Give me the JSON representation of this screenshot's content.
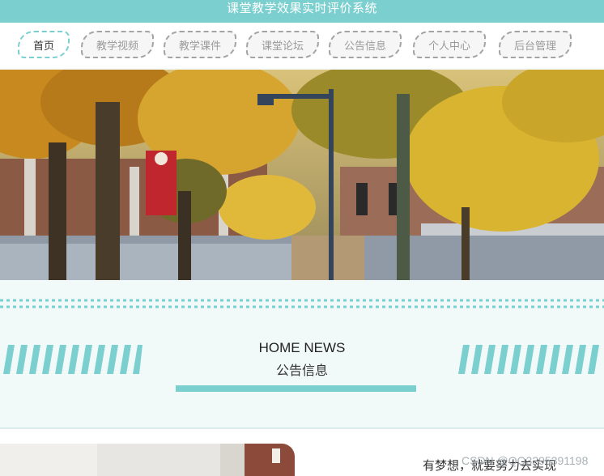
{
  "header": {
    "site_title": "课堂教学效果实时评价系统"
  },
  "nav": {
    "items": [
      {
        "label": "首页",
        "active": true
      },
      {
        "label": "教学视频"
      },
      {
        "label": "教学课件"
      },
      {
        "label": "课堂论坛"
      },
      {
        "label": "公告信息"
      },
      {
        "label": "个人中心"
      },
      {
        "label": "后台管理"
      }
    ]
  },
  "news": {
    "title_en": "HOME NEWS",
    "title_cn": "公告信息"
  },
  "footer_preview": {
    "motto": "有梦想，就要努力去实现",
    "watermark": "CSDN @QQ3295391198"
  },
  "colors": {
    "accent": "#7ccfcf",
    "nav_border": "#a3a3a3"
  }
}
